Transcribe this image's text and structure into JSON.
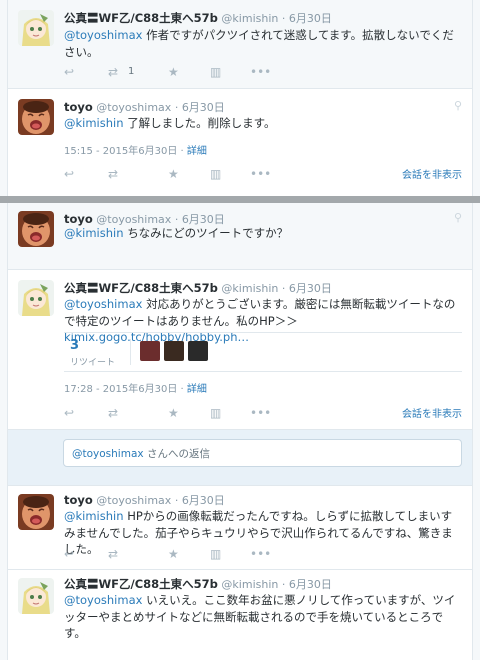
{
  "users": {
    "kimishin": {
      "name": "公真〓WF乙/C88土東へ57b",
      "handle": "@kimishin"
    },
    "toyo": {
      "name": "toyo",
      "handle": "@toyoshimax"
    }
  },
  "actions": {
    "reply": "↩",
    "retweet": "⇄",
    "favorite": "★",
    "stats": "▥",
    "more": "•••"
  },
  "pin_glyph": "⚲",
  "hide_conversation": "会話を非表示",
  "detail_label": "詳細",
  "thread1": {
    "tweet1": {
      "time": "6月30日",
      "mention": "@toyoshimax",
      "text": "作者ですがパクツイされて迷惑してます。拡散しないでください。",
      "retweet_count": "1"
    },
    "tweet2": {
      "time": "6月30日",
      "mention": "@kimishin",
      "text": "了解しました。削除します。",
      "timestamp": "15:15 - 2015年6月30日"
    }
  },
  "thread2": {
    "tweet1": {
      "time": "6月30日",
      "mention": "@kimishin",
      "text": "ちなみにどのツイートですか？"
    },
    "tweet2": {
      "time": "6月30日",
      "mention": "@toyoshimax",
      "text": "対応ありがとうございます。厳密には無断転載ツイートなので特定のツイートはありません。私のHP＞＞",
      "link": "kimix.gogo.tc/hobby/hobby.ph…",
      "retweets": "3",
      "retweets_label": "リツイート",
      "timestamp": "17:28 - 2015年6月30日"
    },
    "reply_placeholder_mention": "@toyoshimax",
    "reply_placeholder_text": "さんへの返信",
    "tweet3": {
      "time": "6月30日",
      "mention": "@kimishin",
      "text": "HPからの画像転載だったんですね。しらずに拡散してしまいすみませんでした。茄子やらキュウリやらで沢山作られてるんですね、驚きました。"
    },
    "tweet4": {
      "time": "6月30日",
      "mention": "@toyoshimax",
      "text": "いえいえ。ここ数年お盆に悪ノリして作っていますが、ツイッターやまとめサイトなどに無断転載されるので手を焼いているところです。"
    }
  },
  "colors": {
    "accent": "#2b7bb9",
    "muted": "#8899a6",
    "divider": "#a3a8ab"
  }
}
